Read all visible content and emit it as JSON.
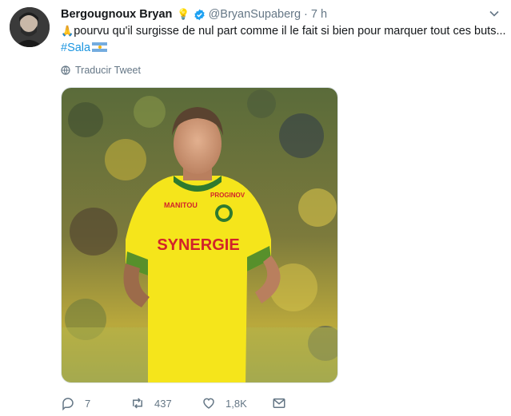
{
  "tweet": {
    "author_name": "Bergougnoux Bryan",
    "handle": "@BryanSupaberg",
    "separator": "·",
    "time": "7 h",
    "text_before": "pourvu qu'il surgisse de nul part comme il le fait si bien pour marquer tout ces buts... ",
    "hashtag": "#Sala",
    "translate_label": "Traducir Tweet"
  },
  "photo": {
    "sponsor": "SYNERGIE",
    "brand": "MANITOU",
    "chest_logo": "PROGINOV"
  },
  "actions": {
    "replies": "7",
    "retweets": "437",
    "likes": "1,8K"
  },
  "colors": {
    "hashtag": "#1b95e0",
    "muted": "#657786",
    "verified": "#1da1f2",
    "jersey": "#f5e51b"
  }
}
